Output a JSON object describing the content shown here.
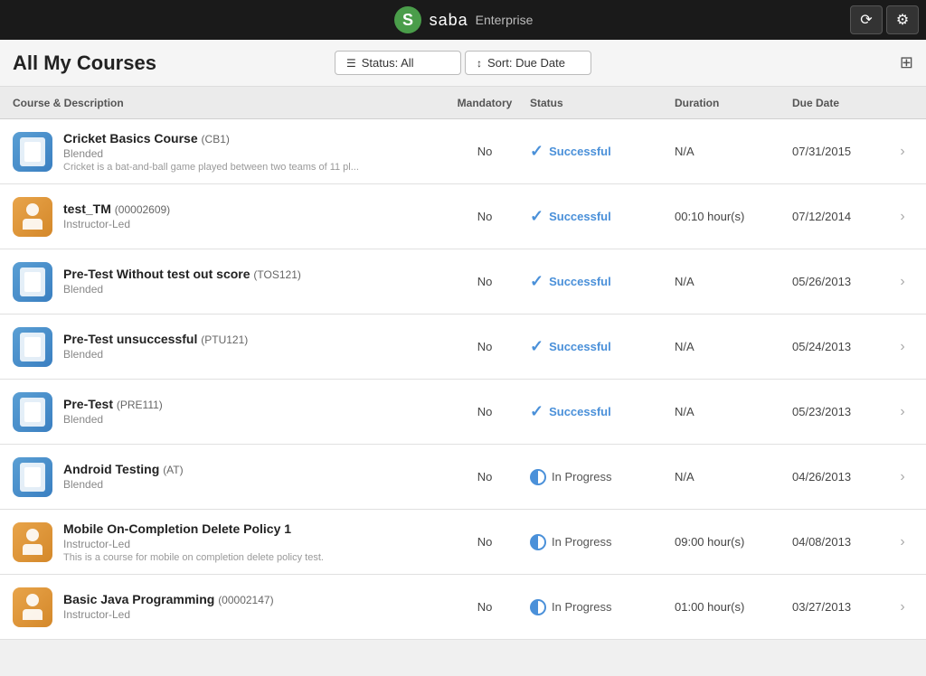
{
  "app": {
    "brand": "saba",
    "brand_type": "Enterprise",
    "refresh_icon": "⟳",
    "settings_icon": "⚙"
  },
  "header": {
    "title": "All My Courses",
    "filter_status_label": "Status: All",
    "filter_sort_label": "Sort: Due Date",
    "grid_icon": "⊞"
  },
  "columns": {
    "course": "Course & Description",
    "mandatory": "Mandatory",
    "status": "Status",
    "duration": "Duration",
    "due_date": "Due Date"
  },
  "courses": [
    {
      "id": 1,
      "name": "Cricket Basics Course",
      "code": "(CB1)",
      "type": "Blended",
      "description": "Cricket is a bat-and-ball game played between two teams of 11 pl...",
      "icon_type": "blended",
      "mandatory": "No",
      "status_type": "successful",
      "status_label": "Successful",
      "duration": "N/A",
      "due_date": "07/31/2015"
    },
    {
      "id": 2,
      "name": "test_TM",
      "code": "(00002609)",
      "type": "Instructor-Led",
      "description": "",
      "icon_type": "instructor",
      "mandatory": "No",
      "status_type": "successful",
      "status_label": "Successful",
      "duration": "00:10 hour(s)",
      "due_date": "07/12/2014"
    },
    {
      "id": 3,
      "name": "Pre-Test Without test out score",
      "code": "(TOS121)",
      "type": "Blended",
      "description": "",
      "icon_type": "blended",
      "mandatory": "No",
      "status_type": "successful",
      "status_label": "Successful",
      "duration": "N/A",
      "due_date": "05/26/2013"
    },
    {
      "id": 4,
      "name": "Pre-Test unsuccessful",
      "code": "(PTU121)",
      "type": "Blended",
      "description": "",
      "icon_type": "blended",
      "mandatory": "No",
      "status_type": "successful",
      "status_label": "Successful",
      "duration": "N/A",
      "due_date": "05/24/2013"
    },
    {
      "id": 5,
      "name": "Pre-Test",
      "code": "(PRE111)",
      "type": "Blended",
      "description": "",
      "icon_type": "blended",
      "mandatory": "No",
      "status_type": "successful",
      "status_label": "Successful",
      "duration": "N/A",
      "due_date": "05/23/2013"
    },
    {
      "id": 6,
      "name": "Android Testing",
      "code": "(AT)",
      "type": "Blended",
      "description": "",
      "icon_type": "blended",
      "mandatory": "No",
      "status_type": "in_progress",
      "status_label": "In Progress",
      "duration": "N/A",
      "due_date": "04/26/2013"
    },
    {
      "id": 7,
      "name": "Mobile On-Completion Delete Policy 1",
      "code": "",
      "type": "Instructor-Led",
      "description": "This is a course for mobile on completion delete policy test.",
      "icon_type": "instructor",
      "mandatory": "No",
      "status_type": "in_progress",
      "status_label": "In Progress",
      "duration": "09:00 hour(s)",
      "due_date": "04/08/2013"
    },
    {
      "id": 8,
      "name": "Basic Java Programming",
      "code": "(00002147)",
      "type": "Instructor-Led",
      "description": "",
      "icon_type": "instructor",
      "mandatory": "No",
      "status_type": "in_progress",
      "status_label": "In Progress",
      "duration": "01:00 hour(s)",
      "due_date": "03/27/2013"
    }
  ]
}
